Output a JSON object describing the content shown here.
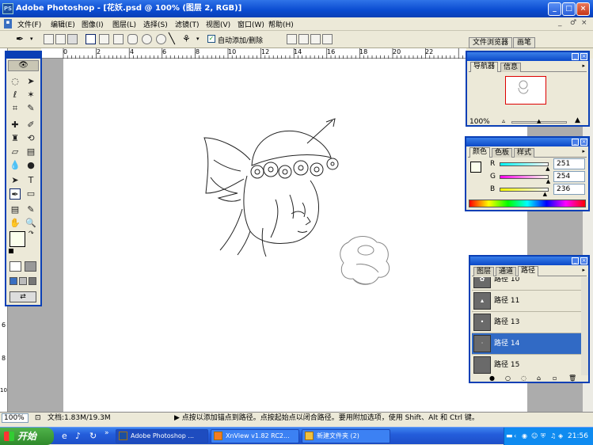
{
  "window": {
    "title": "Adobe Photoshop - [花妖.psd @ 100% (图层 2, RGB)]",
    "app_icon": "PS",
    "min_label": "_",
    "max_label": "□",
    "close_label": "×"
  },
  "menubar": {
    "items": [
      "文件(F)",
      "编辑(E)",
      "图像(I)",
      "图层(L)",
      "选择(S)",
      "滤镜(T)",
      "视图(V)",
      "窗口(W)",
      "帮助(H)"
    ],
    "doc_controls": [
      "_",
      "♂",
      "×"
    ]
  },
  "options_bar": {
    "auto_add_delete_label": "自动添加/删除",
    "auto_add_delete_checked": true
  },
  "palette_well": {
    "tabs": [
      "文件浏览器",
      "画笔"
    ]
  },
  "ruler": {
    "top_ticks": [
      "0",
      "2",
      "4",
      "6",
      "8",
      "10",
      "12",
      "14",
      "16",
      "18",
      "20",
      "22"
    ],
    "left_ticks": [
      "6",
      "8",
      "10"
    ]
  },
  "navigator": {
    "tabs": [
      "导航器",
      "信息"
    ],
    "zoom": "100%"
  },
  "color_panel": {
    "tabs": [
      "颜色",
      "色板",
      "样式"
    ],
    "channels": [
      {
        "label": "R",
        "value": "251",
        "gradient": "linear-gradient(90deg,#00fefc,#fffefc)"
      },
      {
        "label": "G",
        "value": "254",
        "gradient": "linear-gradient(90deg,#fb00ec,#fbffec)"
      },
      {
        "label": "B",
        "value": "236",
        "gradient": "linear-gradient(90deg,#fbfe00,#fbfeff)"
      }
    ],
    "foreground": "#fbfeec"
  },
  "paths_panel": {
    "tabs": [
      "图层",
      "通道",
      "路径"
    ],
    "rows": [
      {
        "label": "路径 10",
        "selected": false
      },
      {
        "label": "路径 11",
        "selected": false
      },
      {
        "label": "路径 13",
        "selected": false
      },
      {
        "label": "路径 14",
        "selected": true
      },
      {
        "label": "路径 15",
        "selected": false
      }
    ]
  },
  "status": {
    "zoom": "100%",
    "doc_size": "文档:1.83M/19.3M",
    "hint": "▶ 点按以添加锚点到路径。点按起始点以闭合路径。要用附加选项，使用 Shift、Alt 和 Ctrl 键。"
  },
  "taskbar": {
    "start_label": "开始",
    "tasks": [
      {
        "label": "Adobe Photoshop ...",
        "active": true
      },
      {
        "label": "XnView v1.82 RC2...",
        "active": false
      },
      {
        "label": "新建文件夹 (2)",
        "active": false
      }
    ],
    "clock": "21:56"
  },
  "colors": {
    "title_blue": "#0a4bd0",
    "selected_row": "#316ac5",
    "panel_bg": "#ece9d8",
    "canvas_gray": "#acacac"
  }
}
